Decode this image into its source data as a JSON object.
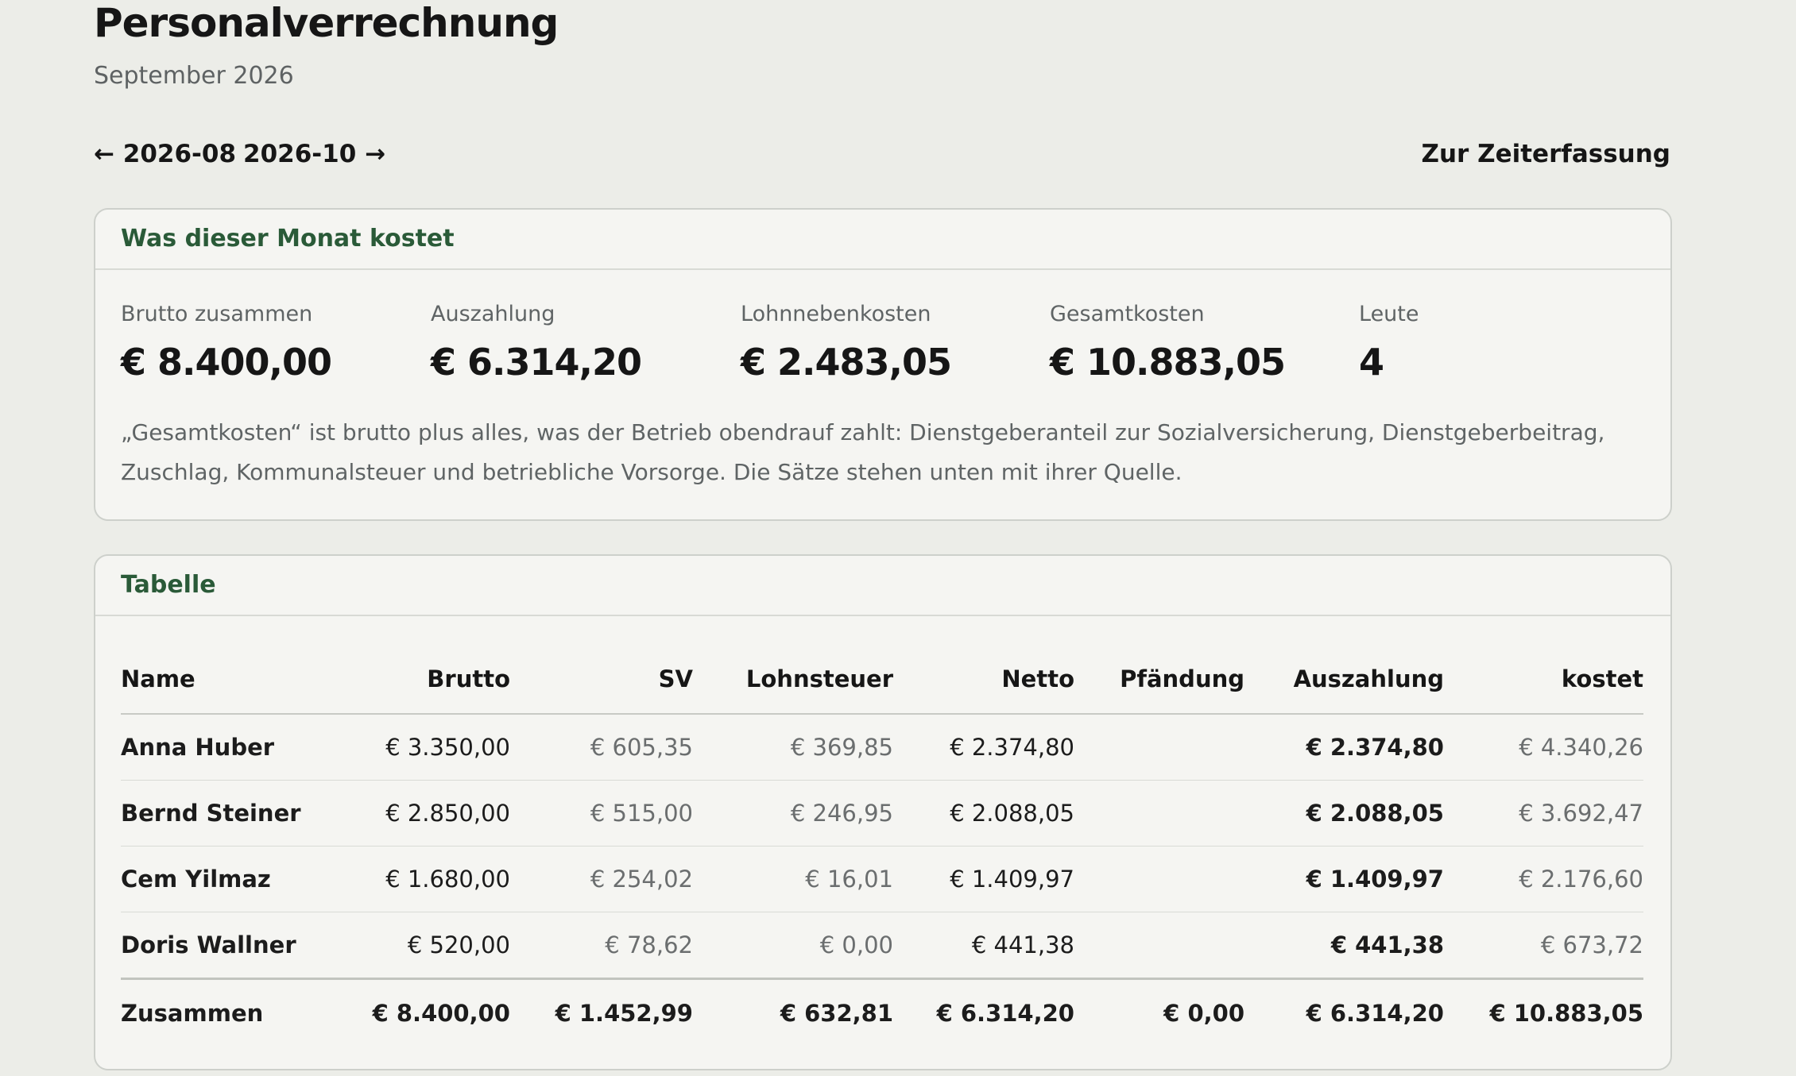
{
  "header": {
    "title": "Personalverrechnung",
    "subtitle": "September 2026"
  },
  "nav": {
    "prev": "← 2026-08",
    "next": "2026-10 →",
    "time_tracking": "Zur Zeiterfassung"
  },
  "cost_card": {
    "title": "Was dieser Monat kostet",
    "stats": [
      {
        "label": "Brutto zusammen",
        "value": "€ 8.400,00"
      },
      {
        "label": "Auszahlung",
        "value": "€ 6.314,20"
      },
      {
        "label": "Lohnnebenkosten",
        "value": "€ 2.483,05"
      },
      {
        "label": "Gesamtkosten",
        "value": "€ 10.883,05"
      },
      {
        "label": "Leute",
        "value": "4"
      }
    ],
    "note": "„Gesamtkosten“ ist brutto plus alles, was der Betrieb obendrauf zahlt: Dienstgeberanteil zur Sozialversicherung, Dienstgeberbeitrag, Zuschlag, Kommunalsteuer und betriebliche Vorsorge. Die Sätze stehen unten mit ihrer Quelle."
  },
  "table_card": {
    "title": "Tabelle",
    "columns": [
      "Name",
      "Brutto",
      "SV",
      "Lohnsteuer",
      "Netto",
      "Pfändung",
      "Auszahlung",
      "kostet"
    ],
    "rows": [
      {
        "name": "Anna Huber",
        "brutto": "€ 3.350,00",
        "sv": "€ 605,35",
        "lohnsteuer": "€ 369,85",
        "netto": "€ 2.374,80",
        "pfaendung": "",
        "auszahlung": "€ 2.374,80",
        "kostet": "€ 4.340,26"
      },
      {
        "name": "Bernd Steiner",
        "brutto": "€ 2.850,00",
        "sv": "€ 515,00",
        "lohnsteuer": "€ 246,95",
        "netto": "€ 2.088,05",
        "pfaendung": "",
        "auszahlung": "€ 2.088,05",
        "kostet": "€ 3.692,47"
      },
      {
        "name": "Cem Yilmaz",
        "brutto": "€ 1.680,00",
        "sv": "€ 254,02",
        "lohnsteuer": "€ 16,01",
        "netto": "€ 1.409,97",
        "pfaendung": "",
        "auszahlung": "€ 1.409,97",
        "kostet": "€ 2.176,60"
      },
      {
        "name": "Doris Wallner",
        "brutto": "€ 520,00",
        "sv": "€ 78,62",
        "lohnsteuer": "€ 0,00",
        "netto": "€ 441,38",
        "pfaendung": "",
        "auszahlung": "€ 441,38",
        "kostet": "€ 673,72"
      }
    ],
    "total": {
      "name": "Zusammen",
      "brutto": "€ 8.400,00",
      "sv": "€ 1.452,99",
      "lohnsteuer": "€ 632,81",
      "netto": "€ 6.314,20",
      "pfaendung": "€ 0,00",
      "auszahlung": "€ 6.314,20",
      "kostet": "€ 10.883,05"
    }
  }
}
